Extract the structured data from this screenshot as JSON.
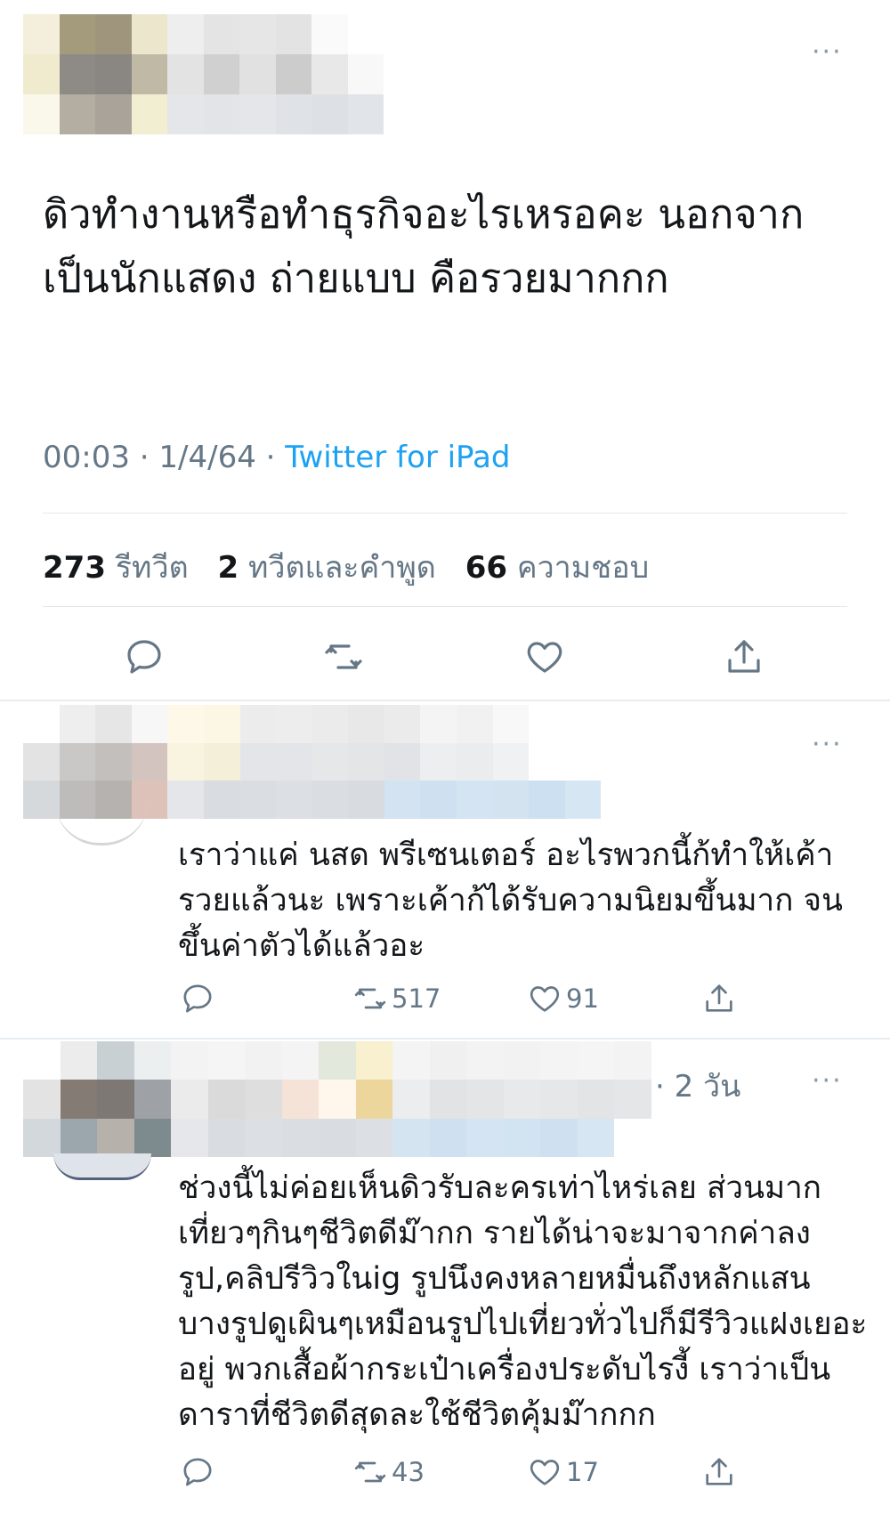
{
  "colors": {
    "text": "#14171a",
    "muted": "#657786",
    "link": "#1da1f2",
    "divider": "#e1e8ed"
  },
  "icons": {
    "more": "more-dots-icon",
    "reply": "speech-bubble-icon",
    "retweet": "retweet-arrows-icon",
    "like": "heart-icon",
    "share": "share-upload-icon"
  },
  "main_tweet": {
    "more_label": "···",
    "text": "ดิวทำงานหรือทำธุรกิจอะไรเหรอคะ นอกจากเป็นนักแสดง ถ่ายแบบ คือรวยมากกก",
    "time": "00:03",
    "sep1": " · ",
    "date": "1/4/64",
    "sep2": " · ",
    "source": "Twitter for iPad",
    "stats": {
      "retweets_count": "273",
      "retweets_label": "รีทวีต",
      "quotes_count": "2",
      "quotes_label": "ทวีตและคำพูด",
      "likes_count": "66",
      "likes_label": "ความชอบ"
    }
  },
  "replies": [
    {
      "more_label": "···",
      "text": "เราว่าแค่ นสด พรีเซนเตอร์ อะไรพวกนี้ก้ทำให้เค้ารวยแล้วนะ เพราะเค้าก้ได้รับความนิยมขึ้นมาก จนขึ้นค่าตัวได้แล้วอะ",
      "retweets": "517",
      "likes": "91"
    },
    {
      "more_label": "···",
      "time": "· 2 วัน",
      "text": "ช่วงนี้ไม่ค่อยเห็นดิวรับละครเท่าไหร่เลย ส่วนมากเที่ยวๆกินๆชีวิตดีม๊ากก รายได้น่าจะมาจากค่าลงรูป,คลิปรีวิวในig รูปนึงคงหลายหมื่นถึงหลักแสน บางรูปดูเผินๆเหมือนรูปไปเที่ยวทั่วไปก็มีรีวิวแฝงเยอะอยู่ พวกเสื้อผ้ากระเป๋าเครื่องประดับไรงี้ เราว่าเป็นดาราที่ชีวิตดีสุดละใช้ชีวิตคุ้มม๊ากกก",
      "retweets": "43",
      "likes": "17"
    }
  ]
}
